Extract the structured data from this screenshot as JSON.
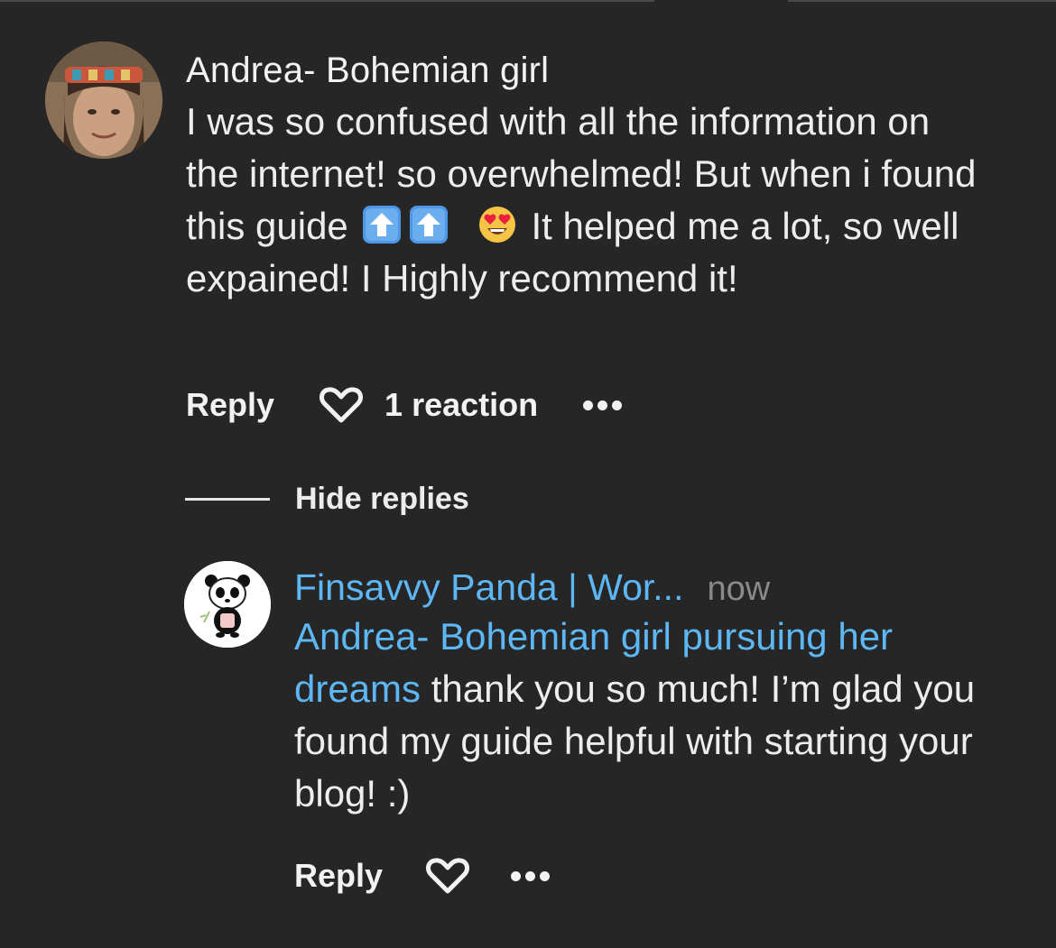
{
  "comment": {
    "author": "Andrea- Bohemian girl",
    "text_before_emoji": "I was so confused with all the information on the internet! so overwhelmed! But when i found this guide ",
    "text_after_emoji": " It helped me a lot, so well expained! I Highly recommend it!",
    "emojis": [
      "up-arrow-emoji",
      "up-arrow-emoji",
      "heart-eyes-emoji"
    ],
    "reply_label": "Reply",
    "reaction_count": "1 reaction"
  },
  "hide_replies_label": "Hide replies",
  "reply": {
    "author": "Finsavvy Panda | Wor...",
    "timestamp": "now",
    "mention": "Andrea- Bohemian girl pursuing her dreams",
    "text": " thank you so much! I’m glad you found my guide helpful with starting your blog! :)",
    "reply_label": "Reply"
  },
  "colors": {
    "background": "#262626",
    "link_blue": "#5db7f5",
    "text": "#ededed",
    "muted": "#8a8a8a"
  }
}
